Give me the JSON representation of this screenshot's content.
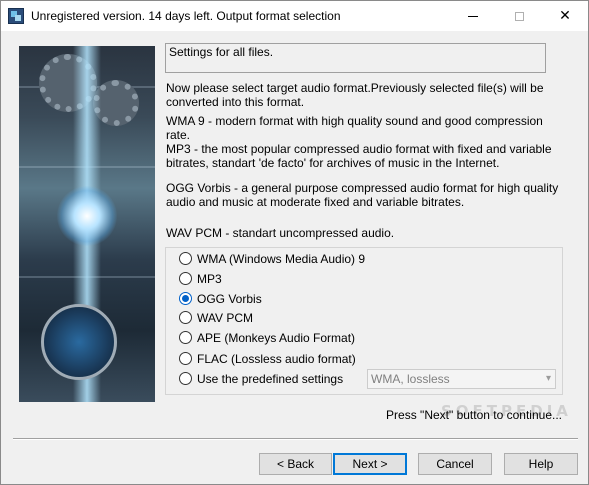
{
  "window": {
    "title": "Unregistered version. 14 days left. Output format selection",
    "controls": {
      "minimize": "minimize-icon",
      "maximize": "maximize-icon",
      "close": "✕"
    }
  },
  "header": {
    "text": "Settings for all files."
  },
  "description": {
    "intro": "Now please select target audio format.Previously selected file(s) will be converted into this format.",
    "wma": "WMA 9 - modern format with high quality sound and good compression rate.",
    "mp3": "MP3 - the most popular compressed audio format with fixed and variable bitrates, standart 'de facto' for archives of music in the Internet.",
    "ogg": "OGG Vorbis  - a general purpose compressed audio format for high quality audio and music at moderate fixed and variable bitrates.",
    "wav": "WAV PCM - standart uncompressed audio."
  },
  "formats": [
    {
      "label": "WMA (Windows Media Audio) 9",
      "checked": false
    },
    {
      "label": "MP3",
      "checked": false
    },
    {
      "label": "OGG Vorbis",
      "checked": true
    },
    {
      "label": "WAV PCM",
      "checked": false
    },
    {
      "label": "APE (Monkeys Audio Format)",
      "checked": false
    },
    {
      "label": "FLAC (Lossless audio format)",
      "checked": false
    },
    {
      "label": "Use the predefined settings",
      "checked": false
    }
  ],
  "preset": {
    "value": "WMA, lossless",
    "enabled": false
  },
  "hint": "Press \"Next\" button to continue...",
  "watermark": "SOFTPEDIA",
  "buttons": {
    "back": "< Back",
    "next": "Next >",
    "cancel": "Cancel",
    "help": "Help"
  },
  "colors": {
    "accent": "#0078d7",
    "radio_checked": "#0060c8",
    "background": "#f0f0f0"
  }
}
